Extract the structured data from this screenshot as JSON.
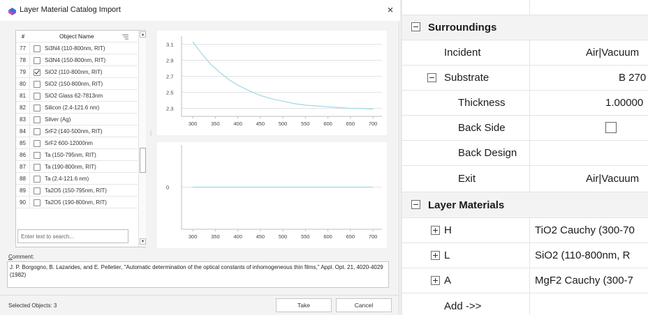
{
  "dialog": {
    "title": "Layer Material Catalog Import",
    "close_glyph": "×",
    "list": {
      "col_number": "#",
      "col_name": "Object Name",
      "rows": [
        {
          "num": "77",
          "name": "Si3N4 (110-800nm, RIT)",
          "checked": false
        },
        {
          "num": "78",
          "name": "Si3N4 (150-800nm, RIT)",
          "checked": false
        },
        {
          "num": "79",
          "name": "SiO2 (110-800nm, RIT)",
          "checked": true
        },
        {
          "num": "80",
          "name": "SiO2 (150-800nm, RIT)",
          "checked": false
        },
        {
          "num": "81",
          "name": "SiO2 Glass 62-7813nm",
          "checked": false
        },
        {
          "num": "82",
          "name": "Silicon (2.4-121.6 nm)",
          "checked": false
        },
        {
          "num": "83",
          "name": "Silver (Ag)",
          "checked": false
        },
        {
          "num": "84",
          "name": "SrF2 (140-500nm, RIT)",
          "checked": false
        },
        {
          "num": "85",
          "name": "SrF2 600-12000nm",
          "checked": false
        },
        {
          "num": "86",
          "name": "Ta (150-795nm, RIT)",
          "checked": false
        },
        {
          "num": "87",
          "name": "Ta (190-800nm, RIT)",
          "checked": false
        },
        {
          "num": "88",
          "name": "Ta (2.4-121.6 nm)",
          "checked": false
        },
        {
          "num": "89",
          "name": "Ta2O5 (150-795nm, RIT)",
          "checked": false
        },
        {
          "num": "90",
          "name": "Ta2O5 (190-800nm, RIT)",
          "checked": false
        }
      ],
      "scroll_position": 0.63,
      "search_placeholder": "Enter text to search..."
    },
    "comment_label_first": "C",
    "comment_label_rest": "omment:",
    "comment_text": "J. P. Borgogno, B. Lazarides, and E. Pelletier, \"Automatic determination of the optical constants of inhomogeneous thin films,\" Appl. Opt. 21, 4020-4029 (1982)",
    "selected_objects": "Selected Objects: 3",
    "take_label": "Take",
    "cancel_label": "Cancel",
    "colors": {
      "curve": "#9fd6e6",
      "grid": "#e2e2e2",
      "axis": "#bdbdbd"
    }
  },
  "chart_data": [
    {
      "type": "line",
      "title": "",
      "xlabel": "",
      "ylabel": "",
      "xlim": [
        275,
        720
      ],
      "ylim": [
        2.2,
        3.2
      ],
      "xticks": [
        300,
        350,
        400,
        450,
        500,
        550,
        600,
        650,
        700
      ],
      "yticks": [
        2.3,
        2.5,
        2.7,
        2.9,
        3.1
      ],
      "grid": true,
      "series": [
        {
          "x": [
            300,
            320,
            340,
            360,
            380,
            400,
            425,
            450,
            475,
            500,
            525,
            550,
            575,
            600,
            625,
            650,
            675,
            700
          ],
          "y": [
            3.13,
            2.98,
            2.85,
            2.75,
            2.66,
            2.59,
            2.52,
            2.46,
            2.42,
            2.39,
            2.36,
            2.34,
            2.33,
            2.32,
            2.31,
            2.3,
            2.3,
            2.29
          ]
        }
      ]
    },
    {
      "type": "line",
      "title": "",
      "xlabel": "",
      "ylabel": "",
      "xlim": [
        275,
        720
      ],
      "ylim": [
        -1,
        1
      ],
      "xticks": [
        300,
        350,
        400,
        450,
        500,
        550,
        600,
        650,
        700
      ],
      "yticks": [
        0
      ],
      "grid": true,
      "series": [
        {
          "x": [
            300,
            700
          ],
          "y": [
            0,
            0
          ]
        }
      ]
    }
  ],
  "property_grid": {
    "surroundings": {
      "label": "Surroundings",
      "incident_label": "Incident",
      "incident_value": "Air|Vacuum",
      "substrate_label": "Substrate",
      "substrate_value": "B 270",
      "thickness_label": "Thickness",
      "thickness_value": "1.00000",
      "back_side_label": "Back Side",
      "back_side_checked": false,
      "back_design_label": "Back Design",
      "back_design_value": "",
      "exit_label": "Exit",
      "exit_value": "Air|Vacuum"
    },
    "layer_materials": {
      "label": "Layer Materials",
      "items": [
        {
          "label": "H",
          "value": "TiO2 Cauchy (300-70"
        },
        {
          "label": "L",
          "value": "SiO2 (110-800nm, R"
        },
        {
          "label": "A",
          "value": "MgF2 Cauchy (300-7"
        }
      ],
      "add_label": "Add ->>"
    }
  }
}
